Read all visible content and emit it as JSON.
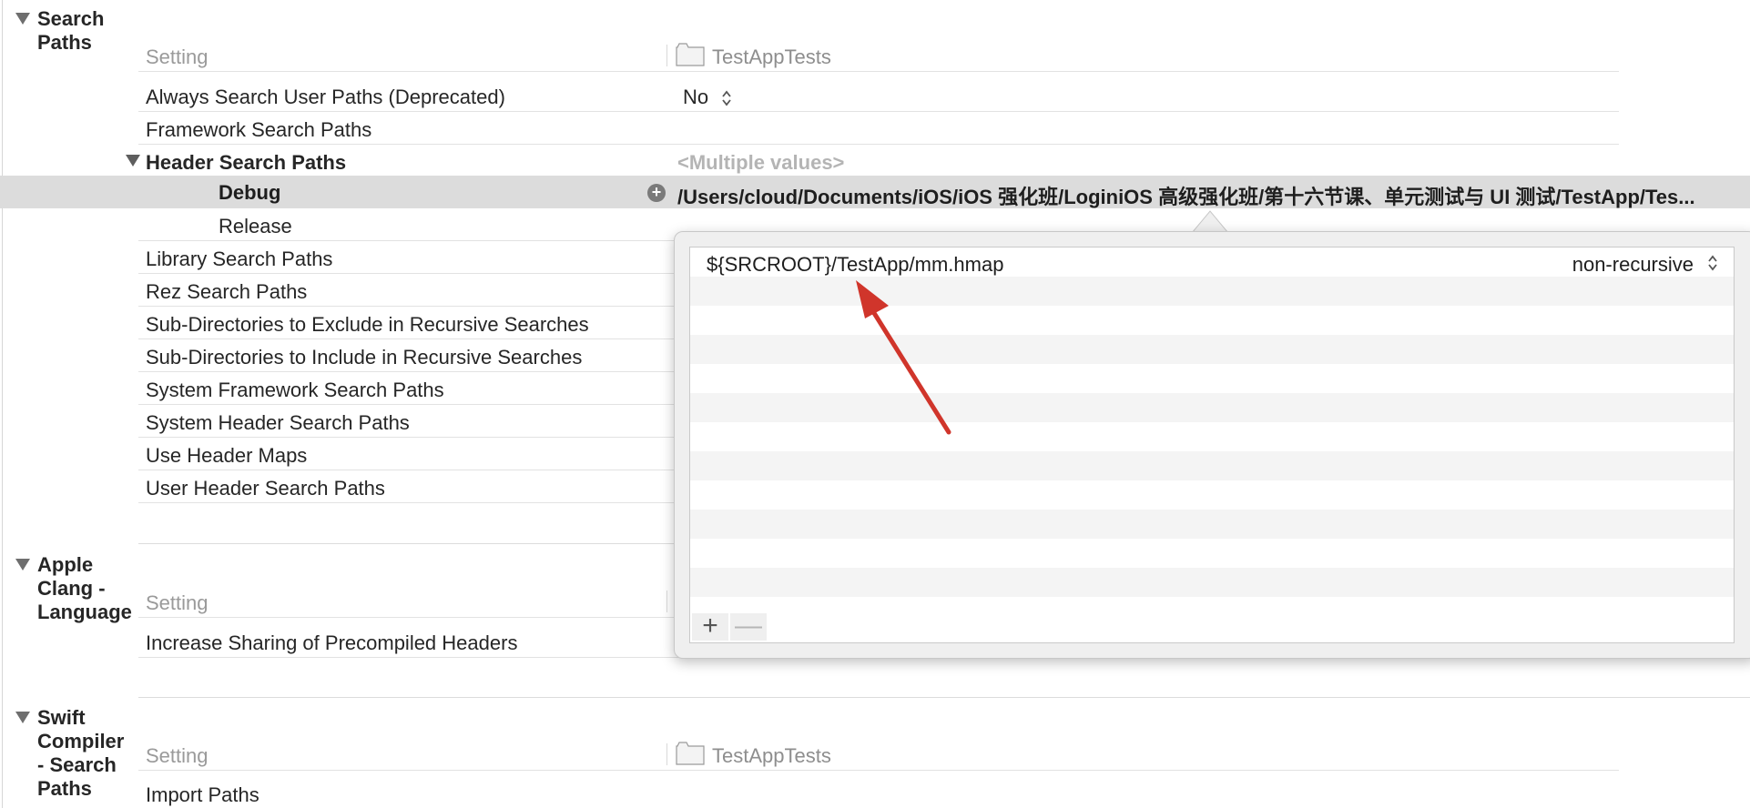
{
  "sections": {
    "search_paths": {
      "title": "Search Paths",
      "header_setting": "Setting",
      "header_target": "TestAppTests",
      "rows": [
        {
          "name": "Always Search User Paths (Deprecated)",
          "value": "No"
        },
        {
          "name": "Framework Search Paths",
          "value": ""
        },
        {
          "name": "Header Search Paths",
          "value": "<Multiple values>"
        },
        {
          "name": "Debug",
          "value": "/Users/cloud/Documents/iOS/iOS 强化班/LoginiOS 高级强化班/第十六节课、单元测试与 UI 测试/TestApp/Tes..."
        },
        {
          "name": "Release",
          "value": ""
        },
        {
          "name": "Library Search Paths",
          "value": ""
        },
        {
          "name": "Rez Search Paths",
          "value": ""
        },
        {
          "name": "Sub-Directories to Exclude in Recursive Searches",
          "value": ""
        },
        {
          "name": "Sub-Directories to Include in Recursive Searches",
          "value": ""
        },
        {
          "name": "System Framework Search Paths",
          "value": ""
        },
        {
          "name": "System Header Search Paths",
          "value": ""
        },
        {
          "name": "Use Header Maps",
          "value": ""
        },
        {
          "name": "User Header Search Paths",
          "value": ""
        }
      ]
    },
    "clang_language": {
      "title": "Apple Clang - Language",
      "header_setting": "Setting",
      "rows": [
        {
          "name": "Increase Sharing of Precompiled Headers",
          "value": ""
        }
      ]
    },
    "swift_search_paths": {
      "title": "Swift Compiler - Search Paths",
      "header_setting": "Setting",
      "header_target": "TestAppTests",
      "rows": [
        {
          "name": "Import Paths",
          "value": ""
        }
      ]
    }
  },
  "popover": {
    "entries": [
      {
        "path": "${SRCROOT}/TestApp/mm.hmap",
        "mode": "non-recursive"
      }
    ],
    "add_label": "+",
    "remove_label": "—"
  },
  "colors": {
    "selected_row": "#dcdcdc",
    "annotation_arrow": "#d0352b"
  }
}
